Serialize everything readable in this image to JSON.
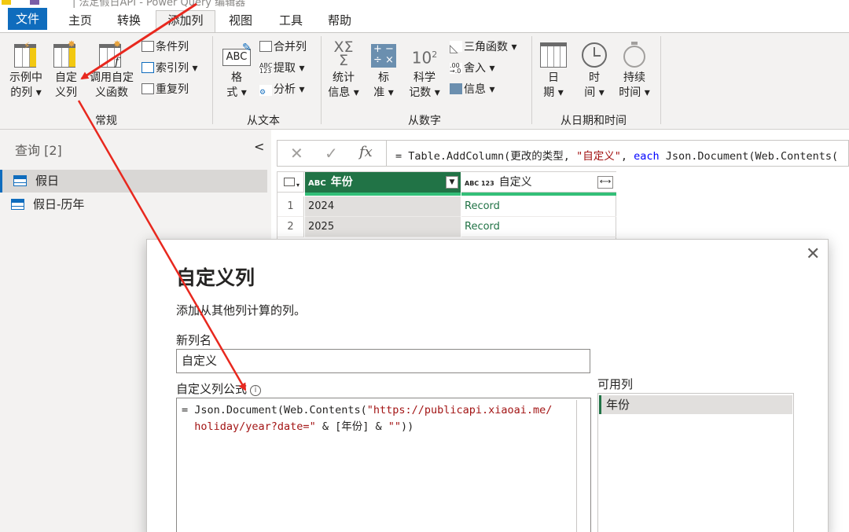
{
  "window": {
    "title": "| 法定假日API - Power Query 编辑器"
  },
  "menu": {
    "tabs": [
      {
        "label": "文件"
      },
      {
        "label": "主页"
      },
      {
        "label": "转换"
      },
      {
        "label": "添加列"
      },
      {
        "label": "视图"
      },
      {
        "label": "工具"
      },
      {
        "label": "帮助"
      }
    ]
  },
  "ribbon": {
    "general": {
      "group_label": "常规",
      "example_col": [
        "示例中",
        "的列 ▾"
      ],
      "custom_col": [
        "自定",
        "义列"
      ],
      "invoke_fn": [
        "调用自定",
        "义函数"
      ],
      "conditional": "条件列",
      "index": "索引列 ▾",
      "duplicate": "重复列"
    },
    "text": {
      "group_label": "从文本",
      "format": [
        "格",
        "式 ▾"
      ],
      "merge": "合并列",
      "extract": "提取 ▾",
      "parse": "分析 ▾"
    },
    "number": {
      "group_label": "从数字",
      "stats": [
        "统计",
        "信息 ▾"
      ],
      "standard": [
        "标",
        "准 ▾"
      ],
      "scientific": [
        "科学",
        "记数 ▾"
      ],
      "trig": "三角函数 ▾",
      "rounding": "舍入 ▾",
      "info": "信息 ▾"
    },
    "datetime": {
      "group_label": "从日期和时间",
      "date": [
        "日",
        "期 ▾"
      ],
      "time": [
        "时",
        "间 ▾"
      ],
      "duration": [
        "持续",
        "时间 ▾"
      ]
    }
  },
  "queries": {
    "title": "查询 [2]",
    "items": [
      {
        "label": "假日"
      },
      {
        "label": "假日-历年"
      }
    ]
  },
  "formula_bar": {
    "fx": "fx",
    "p1": "= Table.AddColumn(更改的类型, ",
    "p2": "\"自定义\"",
    "p3": ", ",
    "p4": "each",
    "p5": " Json.Document(Web.Contents("
  },
  "grid": {
    "columns": [
      {
        "type_tag": "ABC",
        "label": "年份"
      },
      {
        "type_tag": "ABC 123",
        "label": "自定义"
      }
    ],
    "rows": [
      {
        "num": "1",
        "year": "2024",
        "value": "Record"
      },
      {
        "num": "2",
        "year": "2025",
        "value": "Record"
      }
    ]
  },
  "dialog": {
    "title": "自定义列",
    "subtitle": "添加从其他列计算的列。",
    "name_label": "新列名",
    "name_value": "自定义",
    "formula_label": "自定义列公式",
    "formula_l1a": "= Json.Document(Web.Contents(",
    "formula_l1b": "\"https://publicapi.xiaoai.me/",
    "formula_l2a": "holiday/year?date=\"",
    "formula_l2b": " & [年份] & ",
    "formula_l2c": "\"\"",
    "formula_l2d": "))",
    "available_label": "可用列",
    "available_items": [
      "年份"
    ]
  },
  "colors": {
    "accent_blue": "#0f6cbd",
    "header_green": "#217346",
    "annotation_red": "#e8281e"
  }
}
